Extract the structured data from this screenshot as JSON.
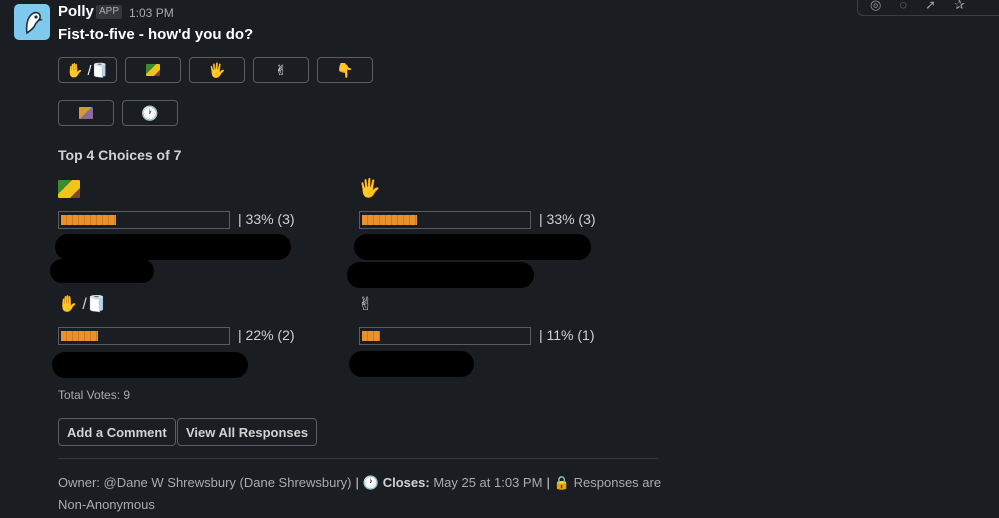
{
  "message": {
    "sender": "Polly",
    "badge": "APP",
    "time": "1:03 PM",
    "question": "Fist-to-five - how'd you do?"
  },
  "option_buttons": [
    {
      "icon": "raised-hand-and-toilet-paper",
      "label": "✋ /🧻"
    },
    {
      "icon": "waving-hand-image",
      "label": ""
    },
    {
      "icon": "raised-hand",
      "label": "🖐"
    },
    {
      "icon": "victory-hand",
      "label": "✌"
    },
    {
      "icon": "pointing-down-hand",
      "label": "👇"
    },
    {
      "icon": "colored-square-image",
      "label": ""
    },
    {
      "icon": "clock",
      "label": "🕐"
    }
  ],
  "results": {
    "title": "Top 4 Choices of 7",
    "choices": [
      {
        "emoji_name": "waving-hand-image",
        "emoji": "",
        "percent": 33,
        "label": "| 33% (3)"
      },
      {
        "emoji_name": "raised-hand",
        "emoji": "🖐",
        "percent": 33,
        "label": "| 33% (3)"
      },
      {
        "emoji_name": "raised-hand-and-toilet-paper",
        "emoji": "✋ /🧻",
        "percent": 22,
        "label": "| 22% (2)"
      },
      {
        "emoji_name": "victory-hand",
        "emoji": "✌",
        "percent": 11,
        "label": "| 11% (1)"
      }
    ],
    "total_label": "Total Votes:",
    "total_value": "9"
  },
  "actions": {
    "comment": "Add a Comment",
    "view_all": "View All Responses"
  },
  "footer": {
    "owner": "Owner: @Dane W Shrewsbury (Dane Shrewsbury)",
    "closes_label": "Closes:",
    "closes_value": "May 25 at 1:03 PM",
    "responses": "Responses are Non-Anonymous"
  },
  "colors": {
    "background": "#1a1d21",
    "bar_fill": "#e8912d",
    "avatar": "#7fc8ee"
  }
}
